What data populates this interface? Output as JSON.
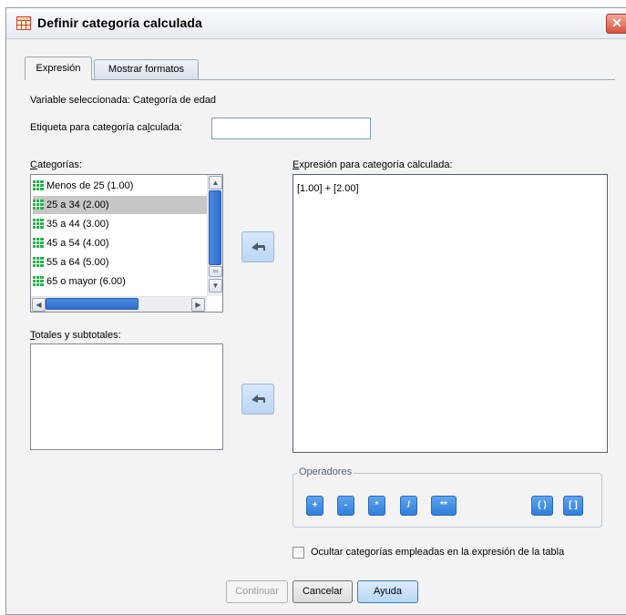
{
  "window": {
    "title": "Definir categoría calculada",
    "close_glyph": "✕"
  },
  "tabs": [
    {
      "label": "Expresión",
      "active": true
    },
    {
      "label": "Mostrar formatos",
      "active": false
    }
  ],
  "variable_line": "Variable seleccionada: Categoría de edad",
  "label_field": {
    "label_before": "Etiqueta para categoría ca",
    "label_hotkey": "l",
    "label_after": "culada:",
    "value": ""
  },
  "categories": {
    "label_hotkey": "C",
    "label_rest": "ategorías:",
    "items": [
      {
        "label": "Menos de 25 (1.00)",
        "selected": false
      },
      {
        "label": "25 a 34 (2.00)",
        "selected": true
      },
      {
        "label": "35 a 44 (3.00)",
        "selected": false
      },
      {
        "label": "45 a 54 (4.00)",
        "selected": false
      },
      {
        "label": "55 a 64 (5.00)",
        "selected": false
      },
      {
        "label": "65 o mayor (6.00)",
        "selected": false
      }
    ]
  },
  "totals": {
    "label_hotkey": "T",
    "label_rest": "otales y subtotales:"
  },
  "expression": {
    "label_hotkey": "E",
    "label_rest": "xpresión para categoría calculada:",
    "value": "[1.00] + [2.00]"
  },
  "operators": {
    "title": "Operadores",
    "buttons": [
      "+",
      "-",
      "*",
      "/",
      "**",
      "( )",
      "[ ]"
    ]
  },
  "hide_option": {
    "label": "Ocultar categorías empleadas en la expresión de la tabla",
    "checked": false
  },
  "buttons": {
    "continue": "Continuar",
    "cancel": "Cancelar",
    "help": "Ayuda"
  },
  "icons": {
    "category_icon": "green-grid-icon",
    "move_arrow": "left-arrow-icon",
    "accent": "#2f7edb",
    "grid_green": "#27b24a"
  }
}
